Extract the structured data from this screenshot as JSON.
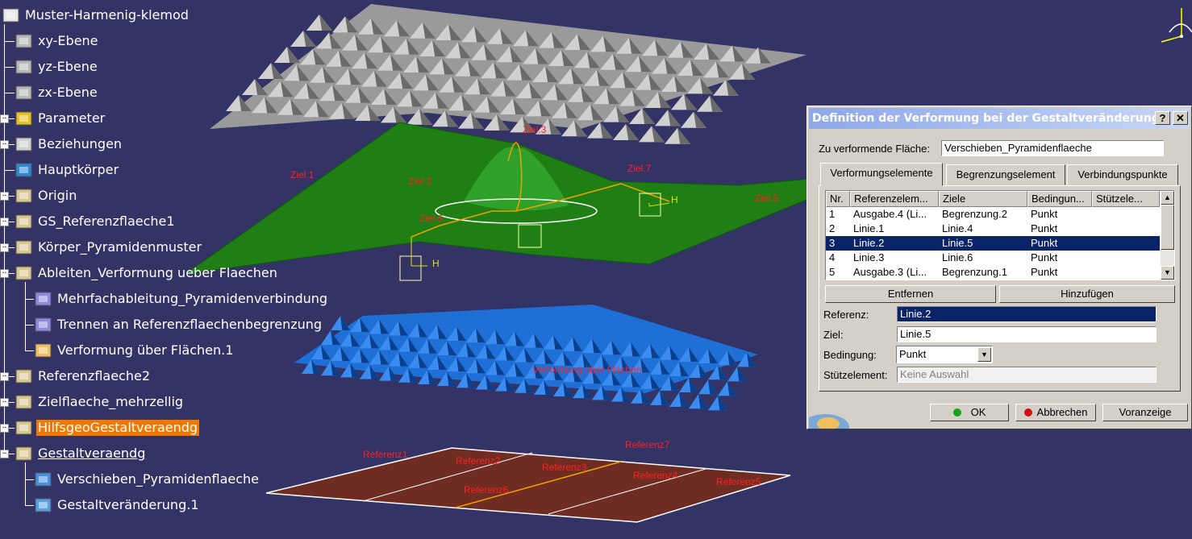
{
  "tree": {
    "items": [
      {
        "label": "Muster-Harmenig-klemod",
        "icon": "part-doc-icon",
        "level": 0
      },
      {
        "label": "xy-Ebene",
        "icon": "plane-icon",
        "level": 1
      },
      {
        "label": "yz-Ebene",
        "icon": "plane-icon",
        "level": 1
      },
      {
        "label": "zx-Ebene",
        "icon": "plane-icon",
        "level": 1
      },
      {
        "label": "Parameter",
        "icon": "parameter-icon",
        "level": 1
      },
      {
        "label": "Beziehungen",
        "icon": "relations-icon",
        "level": 1
      },
      {
        "label": "Hauptkörper",
        "icon": "gear-icon",
        "level": 1
      },
      {
        "label": "Origin",
        "icon": "geoset-icon",
        "level": 1
      },
      {
        "label": "GS_Referenzflaeche1",
        "icon": "geoset-icon",
        "level": 1
      },
      {
        "label": "Körper_Pyramidenmuster",
        "icon": "geoset-icon",
        "level": 1
      },
      {
        "label": "Ableiten_Verformung ueber Flaechen",
        "icon": "geoset-icon",
        "level": 1
      },
      {
        "label": "Mehrfachableitung_Pyramidenverbindung",
        "icon": "surface-icon",
        "level": 2
      },
      {
        "label": "Trennen an Referenzflaechenbegrenzung",
        "icon": "surface-icon",
        "level": 2
      },
      {
        "label": "Verformung über Flächen.1",
        "icon": "deform-icon",
        "level": 2
      },
      {
        "label": "Referenzflaeche2",
        "icon": "geoset-icon",
        "level": 1
      },
      {
        "label": "Zielflaeche_mehrzellig",
        "icon": "geoset-icon",
        "level": 1
      },
      {
        "label": "HilfsgeoGestaltveraendg",
        "icon": "geoset-icon",
        "level": 1
      },
      {
        "label": "Gestaltveraendg",
        "icon": "geoset-icon",
        "level": 1
      },
      {
        "label": "Verschieben_Pyramidenflaeche",
        "icon": "translate-icon",
        "level": 2
      },
      {
        "label": "Gestaltveränderung.1",
        "icon": "shape-morph-icon",
        "level": 2
      }
    ],
    "highlight_color": "#f07800"
  },
  "viewport": {
    "labels": {
      "ziel1": "Ziel.1",
      "ziel2": "Ziel.2",
      "ziel3": "Ziel.3",
      "ziel5": "Ziel.5",
      "ziel6": "Ziel.6",
      "ziel7": "Ziel.7",
      "h": "H",
      "blue_annotation": "Verformung über Flächen",
      "ref1": "Referenz1",
      "ref2": "Referenz2",
      "ref3": "Referenz3",
      "ref4": "Referenz4",
      "ref5": "Referenz5",
      "ref6": "Referenz6",
      "ref7": "Referenz7"
    },
    "compass_icon": "compass-icon",
    "colors": {
      "background": "#333366",
      "green_surface": "#1f7f14",
      "blue_surface": "#1e6fd6",
      "gray_surface": "#b8b8b8",
      "brown_surface": "#6e2c22",
      "label": "#ff2020"
    }
  },
  "dialog": {
    "title": "Definition der Verformung bei der Gestaltveränderung",
    "help_label": "?",
    "close_label": "✕",
    "surface_label": "Zu verformende Fläche:",
    "surface_value": "Verschieben_Pyramidenflaeche",
    "tabs": [
      {
        "label": "Verformungselemente",
        "active": true
      },
      {
        "label": "Begrenzungselement",
        "active": false
      },
      {
        "label": "Verbindungspunkte",
        "active": false
      }
    ],
    "table": {
      "columns": [
        "Nr.",
        "Referenzelem...",
        "Ziele",
        "Bedingun...",
        "Stützele..."
      ],
      "rows": [
        {
          "nr": "1",
          "ref": "Ausgabe.4 (Li...",
          "ziel": "Begrenzung.2",
          "bed": "Punkt",
          "stuetz": "",
          "selected": false
        },
        {
          "nr": "2",
          "ref": "Linie.1",
          "ziel": "Linie.4",
          "bed": "Punkt",
          "stuetz": "",
          "selected": false
        },
        {
          "nr": "3",
          "ref": "Linie.2",
          "ziel": "Linie.5",
          "bed": "Punkt",
          "stuetz": "",
          "selected": true
        },
        {
          "nr": "4",
          "ref": "Linie.3",
          "ziel": "Linie.6",
          "bed": "Punkt",
          "stuetz": "",
          "selected": false
        },
        {
          "nr": "5",
          "ref": "Ausgabe.3 (Li...",
          "ziel": "Begrenzung.1",
          "bed": "Punkt",
          "stuetz": "",
          "selected": false
        }
      ]
    },
    "remove_button": "Entfernen",
    "add_button": "Hinzufügen",
    "reference_label": "Referenz:",
    "reference_value": "Linie.2",
    "target_label": "Ziel:",
    "target_value": "Linie.5",
    "condition_label": "Bedingung:",
    "condition_value": "Punkt",
    "support_label": "Stützelement:",
    "support_placeholder": "Keine Auswahl",
    "ok_button": "OK",
    "cancel_button": "Abbrechen",
    "preview_button": "Voranzeige",
    "colors": {
      "selection": "#0a246a",
      "ok_dot": "#1aa01a",
      "cancel_dot": "#d01010"
    }
  }
}
